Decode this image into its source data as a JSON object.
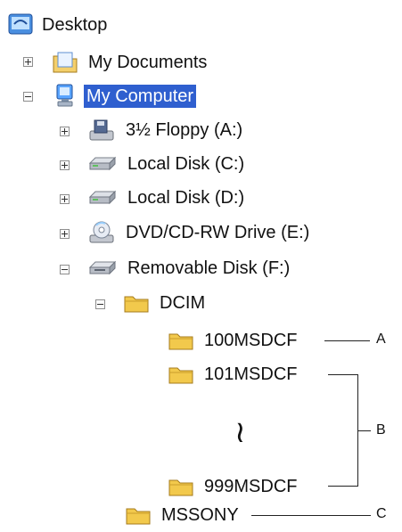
{
  "tree": {
    "root": {
      "label": "Desktop",
      "icon": "desktop-icon"
    },
    "items": [
      {
        "label": "My Documents",
        "icon": "folder-documents-icon",
        "expander": "plus"
      },
      {
        "label": "My Computer",
        "icon": "computer-icon",
        "expander": "minus",
        "selected": true
      },
      {
        "label": "3½ Floppy (A:)",
        "icon": "floppy-drive-icon",
        "expander": "plus"
      },
      {
        "label": "Local Disk (C:)",
        "icon": "hard-disk-icon",
        "expander": "plus"
      },
      {
        "label": "Local Disk (D:)",
        "icon": "hard-disk-icon",
        "expander": "plus"
      },
      {
        "label": "DVD/CD-RW Drive (E:)",
        "icon": "cd-drive-icon",
        "expander": "plus"
      },
      {
        "label": "Removable Disk (F:)",
        "icon": "removable-disk-icon",
        "expander": "minus"
      },
      {
        "label": "DCIM",
        "icon": "folder-icon",
        "expander": "minus"
      },
      {
        "label": "100MSDCF",
        "icon": "folder-icon"
      },
      {
        "label": "101MSDCF",
        "icon": "folder-icon"
      },
      {
        "label": "999MSDCF",
        "icon": "folder-icon"
      },
      {
        "label": "MSSONY",
        "icon": "folder-icon"
      }
    ]
  },
  "callouts": {
    "a": "A",
    "b": "B",
    "c": "C",
    "ellipsis": "≀"
  },
  "colors": {
    "selection": "#2f5fcf",
    "folder": "#f2c94c"
  }
}
